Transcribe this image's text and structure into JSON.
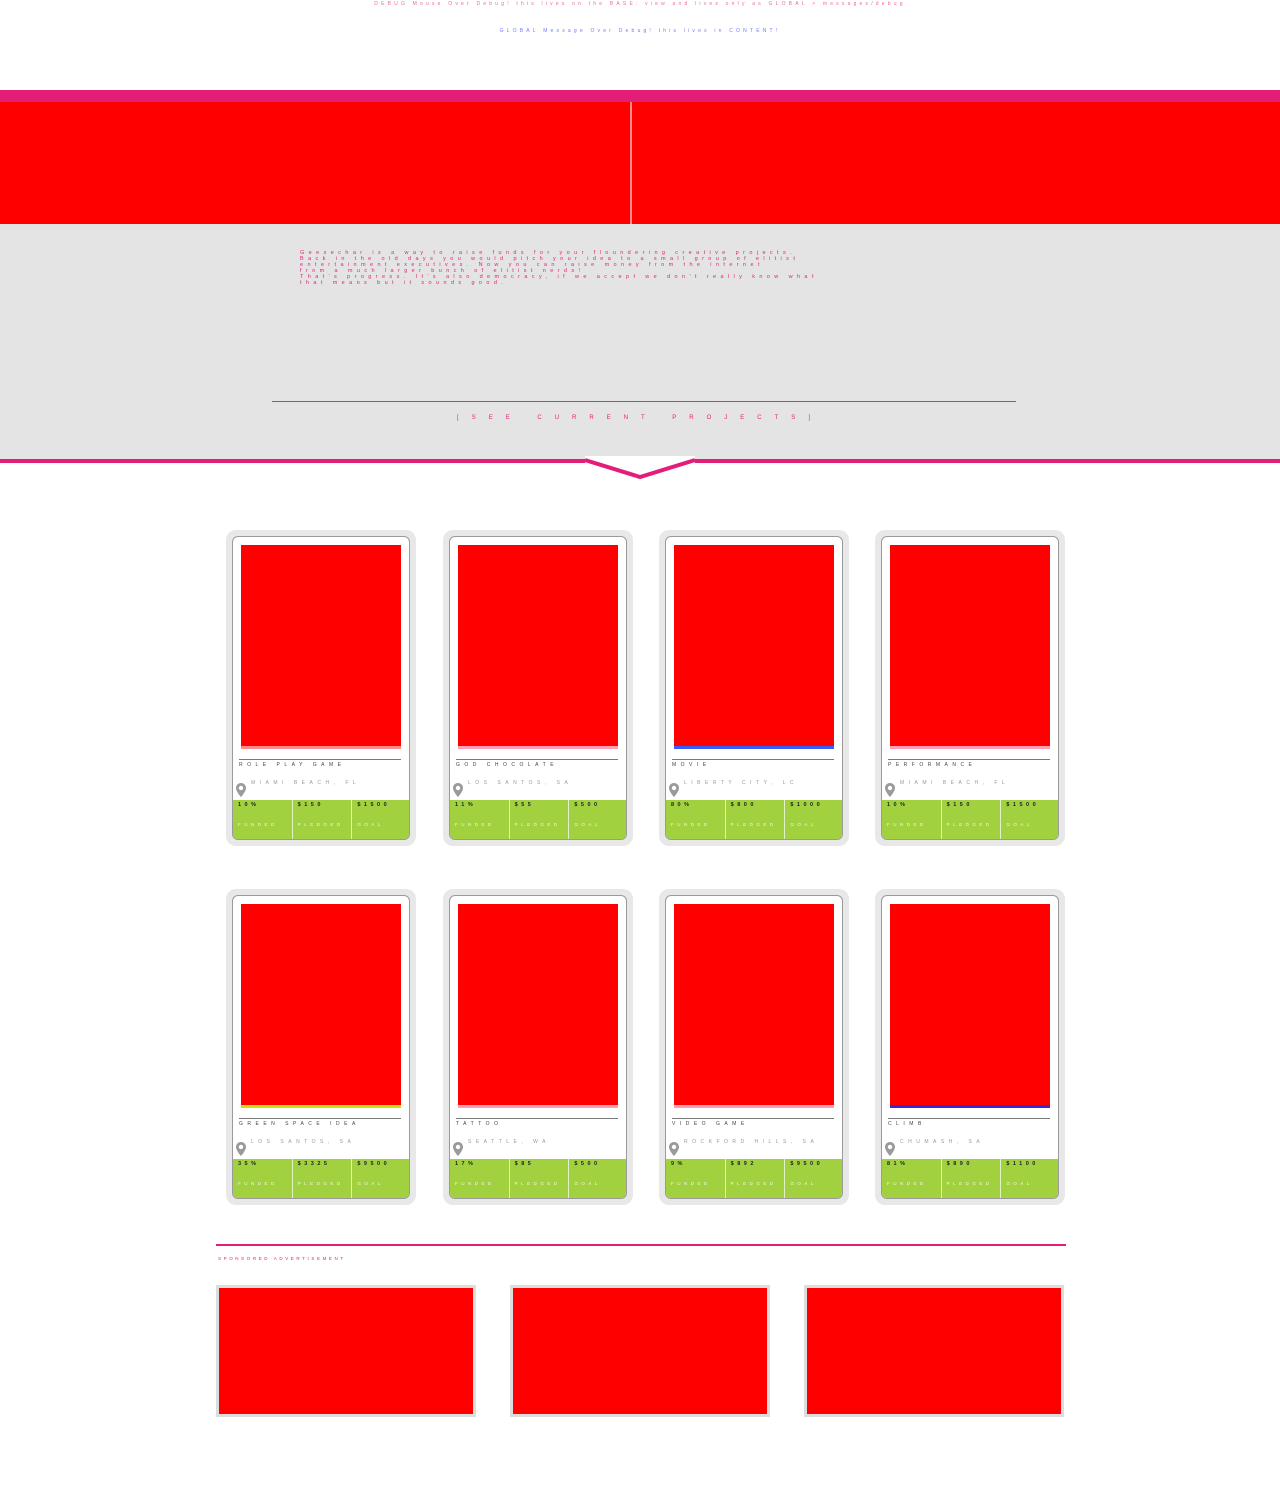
{
  "notices": {
    "line1": "DEBUG Mouse Over Debug! this lives on the BASE: view and lives only as GLOBAL > messages/debug",
    "line2": "GLOBAL Message Over Debug! this lives in CONTENT!"
  },
  "about": {
    "text": "Geesechar is a way to raise funds for your floundering creative projects.\nBack in the old days you would pitch your idea to a small group of elitist\nentertainment executives. Now you can raise money from the internet\nfrom a much larger bunch of elitist nerds!\nThat's progress. It's also democracy, if we accept we don't really know what\nthat means but it sounds good.",
    "link_label": "[SEE CURRENT PROJECTS]"
  },
  "colors": {
    "accent": "#e41e78",
    "hero": "#ff0000",
    "stats_green": "#a2d140",
    "panel_gray": "#e4e4e4"
  },
  "projects": [
    {
      "title": "ROLE PLAY GAME",
      "location": "MIAMI BEACH, FL",
      "funded": "10%",
      "pledged": "$150",
      "goal": "$1500",
      "funded_label": "FUNDED",
      "pledged_label": "PLEDGED",
      "goal_label": "GOAL",
      "image_accent": "#ff8a8a"
    },
    {
      "title": "GOD CHOCOLATE",
      "location": "LOS SANTOS, SA",
      "funded": "11%",
      "pledged": "$55",
      "goal": "$500",
      "funded_label": "FUNDED",
      "pledged_label": "PLEDGED",
      "goal_label": "GOAL",
      "image_accent": "#ff9fb5"
    },
    {
      "title": "MOVIE",
      "location": "LIBERTY CITY, LC",
      "funded": "80%",
      "pledged": "$800",
      "goal": "$1000",
      "funded_label": "FUNDED",
      "pledged_label": "PLEDGED",
      "goal_label": "GOAL",
      "image_accent": "#3a5cff"
    },
    {
      "title": "PERFORMANCE",
      "location": "MIAMI BEACH, FL",
      "funded": "10%",
      "pledged": "$150",
      "goal": "$1500",
      "funded_label": "FUNDED",
      "pledged_label": "PLEDGED",
      "goal_label": "GOAL",
      "image_accent": "#ff9fb5"
    },
    {
      "title": "GREEN SPACE IDEA",
      "location": "LOS SANTOS, SA",
      "funded": "35%",
      "pledged": "$3325",
      "goal": "$9500",
      "funded_label": "FUNDED",
      "pledged_label": "PLEDGED",
      "goal_label": "GOAL",
      "image_accent": "#c5e600"
    },
    {
      "title": "TATTOO",
      "location": "SEATTLE, WA",
      "funded": "17%",
      "pledged": "$85",
      "goal": "$500",
      "funded_label": "FUNDED",
      "pledged_label": "PLEDGED",
      "goal_label": "GOAL",
      "image_accent": "#ff9fb5"
    },
    {
      "title": "VIDEO GAME",
      "location": "ROCKFORD HILLS, SA",
      "funded": "9%",
      "pledged": "$892",
      "goal": "$9500",
      "funded_label": "FUNDED",
      "pledged_label": "PLEDGED",
      "goal_label": "GOAL",
      "image_accent": "#ff9fb5"
    },
    {
      "title": "CLIMB",
      "location": "CHUMASH, SA",
      "funded": "81%",
      "pledged": "$890",
      "goal": "$1100",
      "funded_label": "FUNDED",
      "pledged_label": "PLEDGED",
      "goal_label": "GOAL",
      "image_accent": "#3a2bd6"
    }
  ],
  "sponsored": {
    "label": "SPONSORED ADVERTISEMENT"
  }
}
